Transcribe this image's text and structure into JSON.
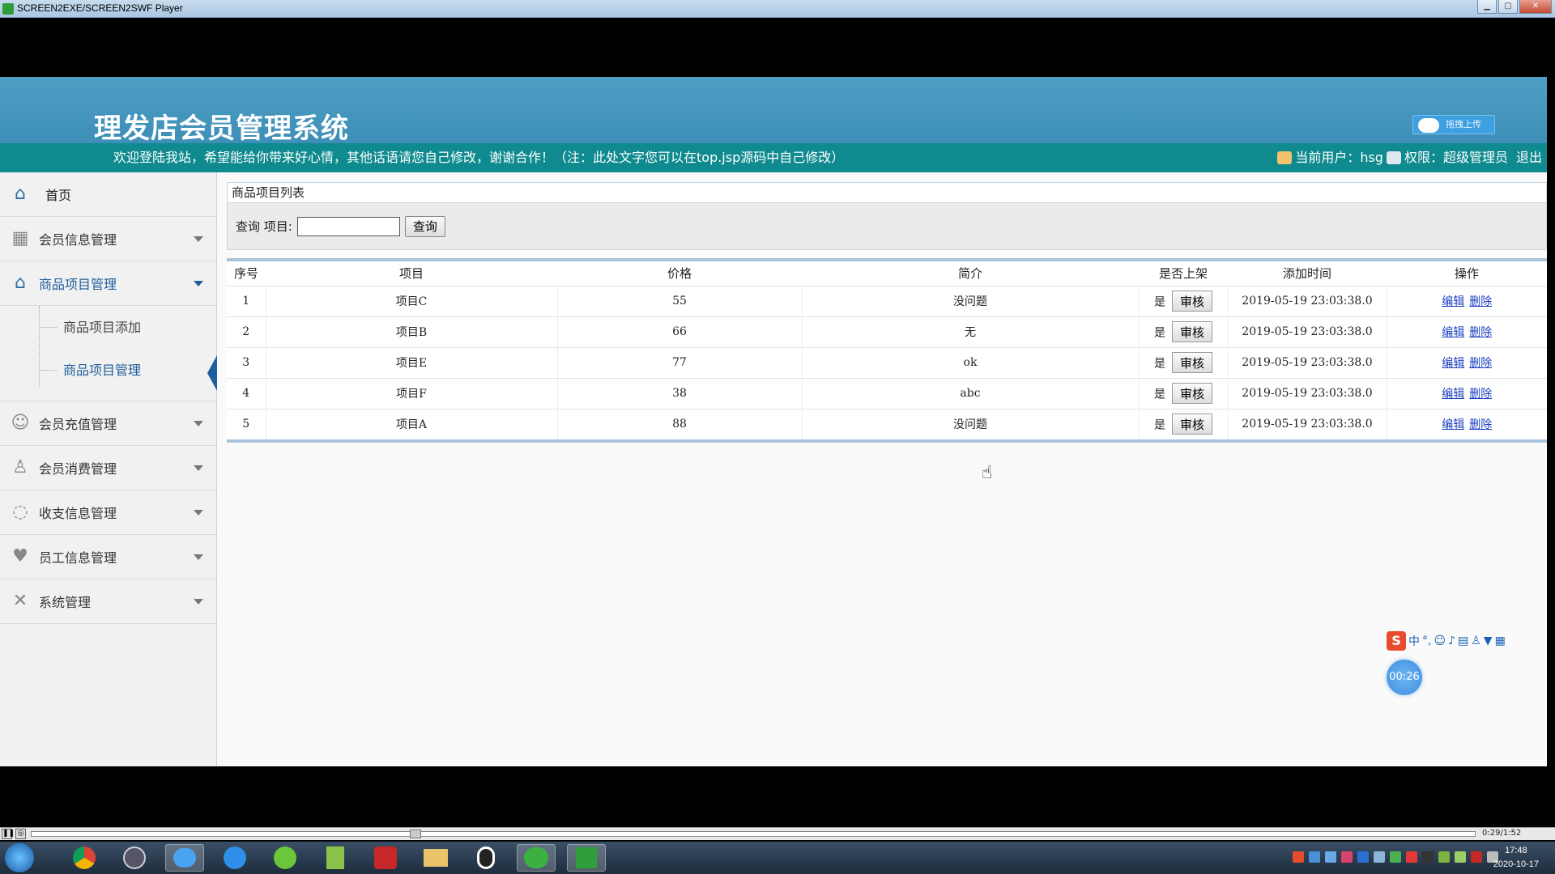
{
  "window": {
    "title": "SCREEN2EXE/SCREEN2SWF Player"
  },
  "header": {
    "site_title": "理发店会员管理系统",
    "upload_label": "拖拽上传",
    "welcome": "欢迎登陆我站，希望能给你带来好心情，其他话语请您自己修改，谢谢合作！（注：此处文字您可以在top.jsp源码中自己修改）",
    "current_user_label": "当前用户：hsg",
    "role_label": "权限：超级管理员",
    "logout_label": "退出"
  },
  "sidebar": {
    "home": "首页",
    "items": [
      {
        "label": "会员信息管理",
        "icon": "grid-icon"
      },
      {
        "label": "商品项目管理",
        "icon": "home-icon"
      },
      {
        "label": "会员充值管理",
        "icon": "users-icon"
      },
      {
        "label": "会员消费管理",
        "icon": "user-icon"
      },
      {
        "label": "收支信息管理",
        "icon": "chat-icon"
      },
      {
        "label": "员工信息管理",
        "icon": "heart-icon"
      },
      {
        "label": "系统管理",
        "icon": "tools-icon"
      }
    ],
    "sub_items": [
      "商品项目添加",
      "商品项目管理"
    ]
  },
  "main": {
    "panel_title": "商品项目列表",
    "search": {
      "label": "查询 项目:",
      "value": "",
      "button": "查询"
    },
    "columns": [
      "序号",
      "项目",
      "价格",
      "简介",
      "是否上架",
      "添加时间",
      "操作"
    ],
    "rows": [
      {
        "no": "1",
        "item": "项目C",
        "price": "55",
        "intro": "没问题",
        "listed": "是",
        "audit": "审核",
        "time": "2019-05-19 23:03:38.0",
        "edit": "编辑",
        "del": "删除"
      },
      {
        "no": "2",
        "item": "项目B",
        "price": "66",
        "intro": "无",
        "listed": "是",
        "audit": "审核",
        "time": "2019-05-19 23:03:38.0",
        "edit": "编辑",
        "del": "删除"
      },
      {
        "no": "3",
        "item": "项目E",
        "price": "77",
        "intro": "ok",
        "listed": "是",
        "audit": "审核",
        "time": "2019-05-19 23:03:38.0",
        "edit": "编辑",
        "del": "删除"
      },
      {
        "no": "4",
        "item": "项目F",
        "price": "38",
        "intro": "abc",
        "listed": "是",
        "audit": "审核",
        "time": "2019-05-19 23:03:38.0",
        "edit": "编辑",
        "del": "删除"
      },
      {
        "no": "5",
        "item": "项目A",
        "price": "88",
        "intro": "没问题",
        "listed": "是",
        "audit": "审核",
        "time": "2019-05-19 23:03:38.0",
        "edit": "编辑",
        "del": "删除"
      }
    ]
  },
  "ime": {
    "logo": "S",
    "mode": "中"
  },
  "timer": "00:26",
  "player": {
    "time": "0:29/1:52"
  },
  "taskbar": {
    "time": "17:48",
    "date": "2020-10-17"
  },
  "colors": {
    "banner": "#3d8fb8",
    "notice_bar": "#0f8a8e",
    "accent": "#1f5e9c"
  }
}
